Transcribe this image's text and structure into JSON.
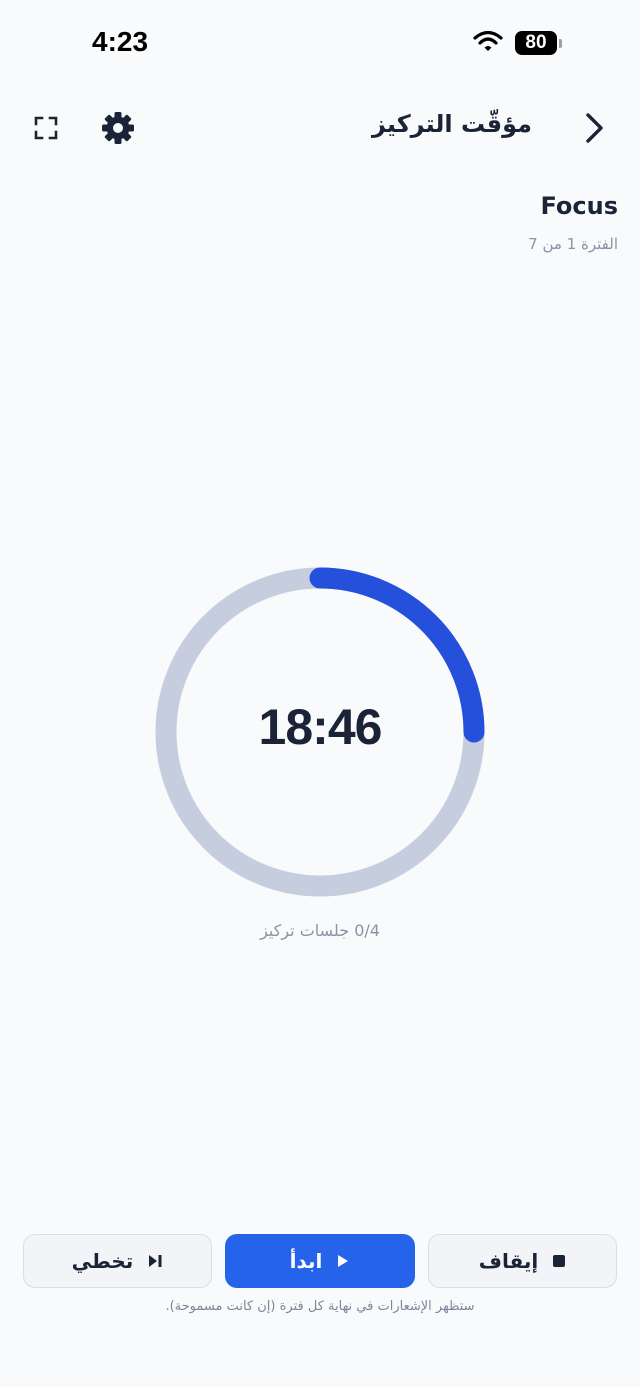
{
  "status_bar": {
    "time": "4:23",
    "battery": "80"
  },
  "header": {
    "title": "مؤقّت التركيز"
  },
  "timer": {
    "label": "Focus",
    "period": "الفترة 1 من 7",
    "time": "18:46",
    "progress": 0.25,
    "sessions": "0/4 جلسات تركيز"
  },
  "buttons": {
    "skip": "تخطي",
    "start": "ابدأ",
    "stop": "إيقاف"
  },
  "note": "ستظهر الإشعارات في نهاية كل فترة (إن كانت مسموحة).",
  "colors": {
    "accent": "#2563eb",
    "ring_track": "#c6cddf",
    "text": "#1b2437"
  }
}
